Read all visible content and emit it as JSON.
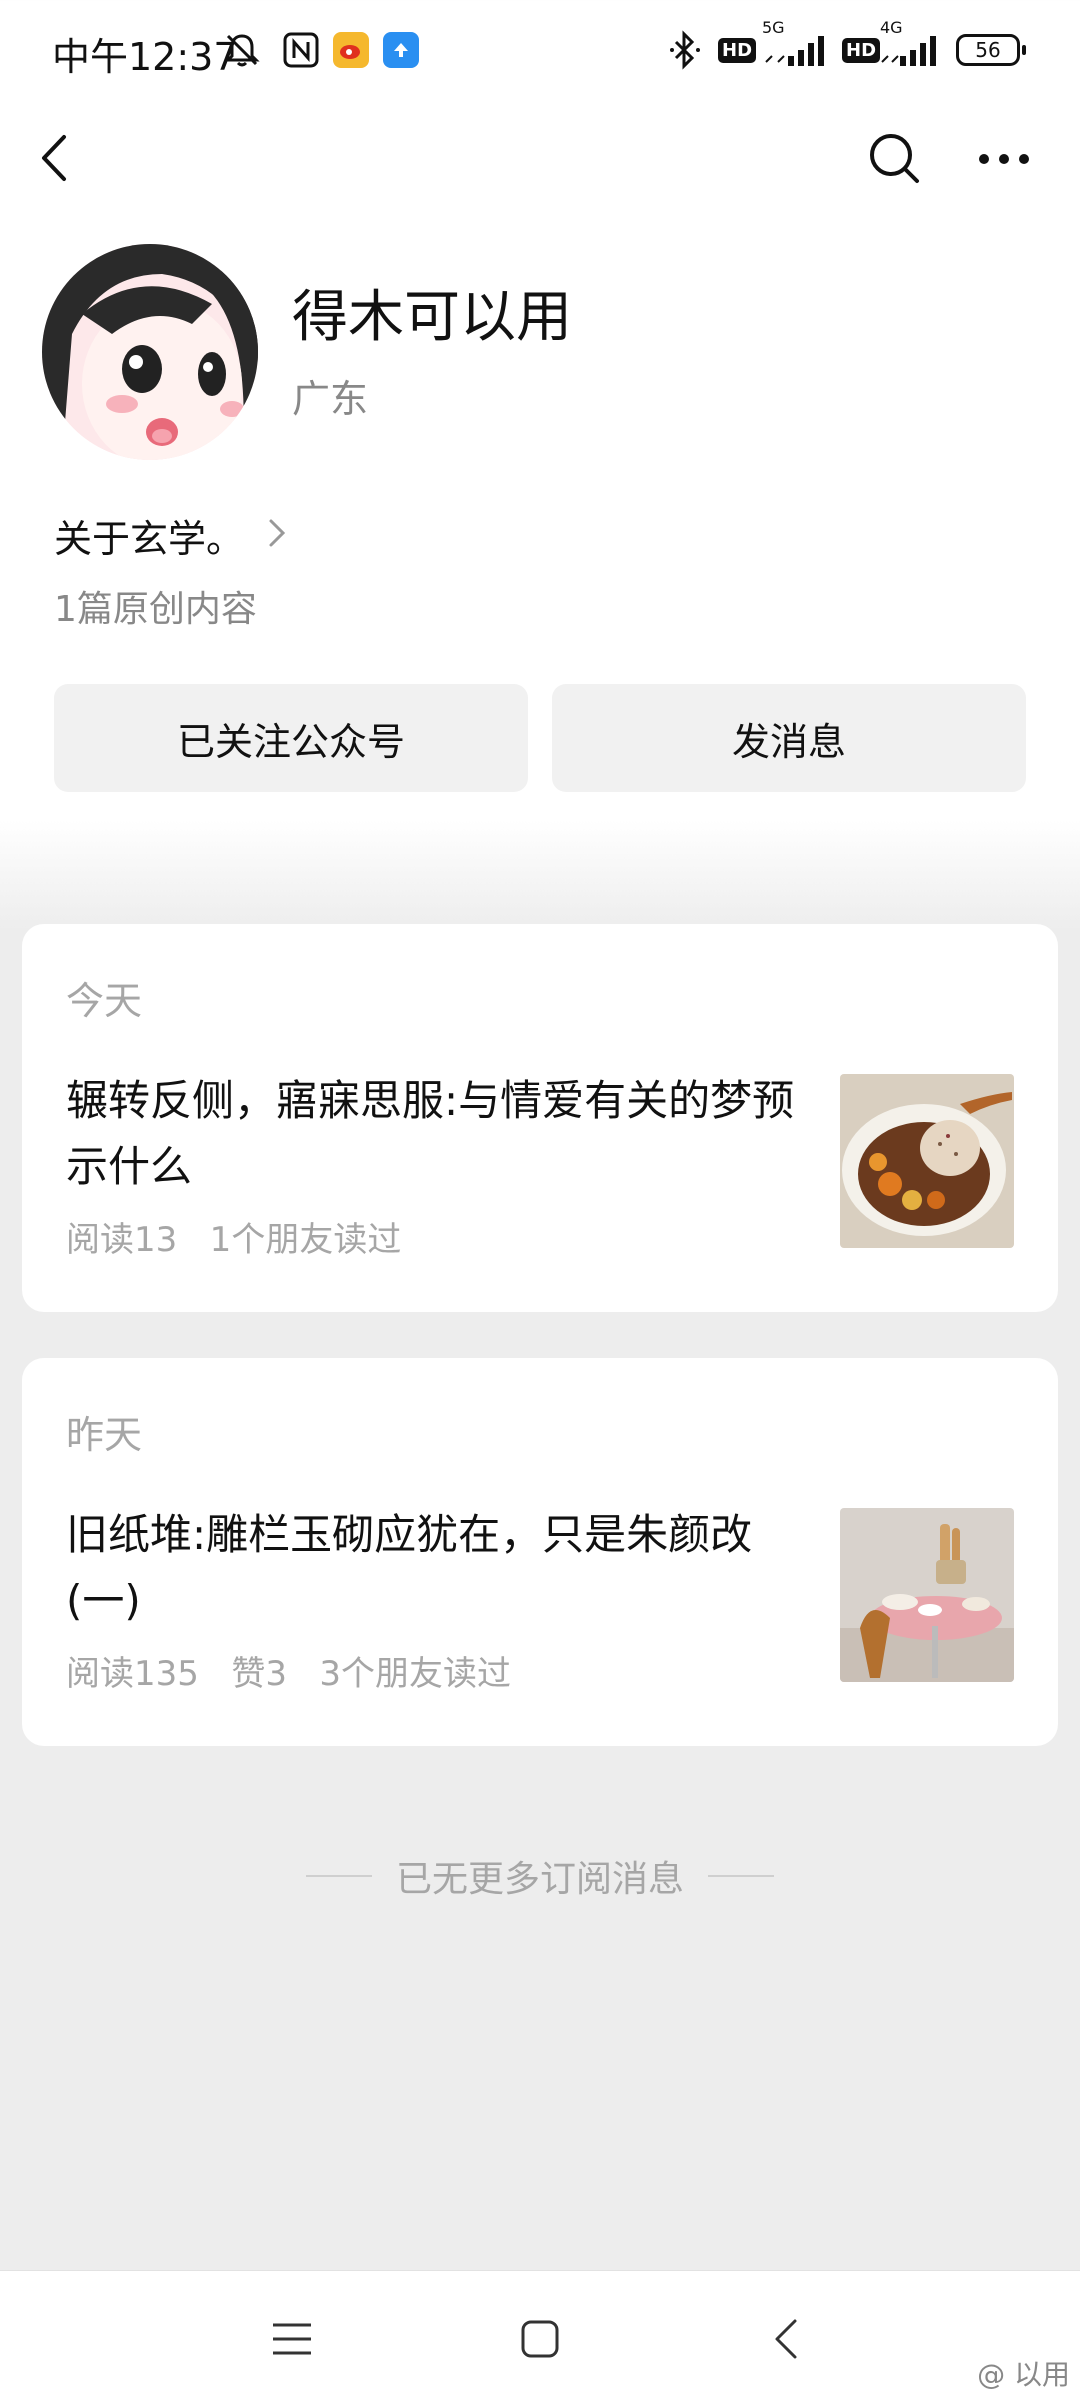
{
  "status_bar": {
    "time": "中午12:37",
    "network1": "5G",
    "network2": "4G",
    "hd": "HD",
    "battery": "56"
  },
  "nav": {
    "back_icon": "back-icon",
    "search_icon": "search-icon",
    "more_icon": "more-icon"
  },
  "profile": {
    "name": "得木可以用",
    "region": "广东",
    "description": "关于玄学。",
    "original_count": "1篇原创内容"
  },
  "actions": {
    "follow_label": "已关注公众号",
    "message_label": "发消息"
  },
  "articles": [
    {
      "date": "今天",
      "title": "辗转反侧，寤寐思服:与情爱有关的梦预示什么",
      "meta": "阅读13   1个朋友读过"
    },
    {
      "date": "昨天",
      "title": "旧纸堆:雕栏玉砌应犹在，只是朱颜改(一)",
      "meta": "阅读135   赞3   3个朋友读过"
    }
  ],
  "footer": {
    "end_text": "已无更多订阅消息"
  },
  "watermark": "@         以用",
  "colors": {
    "background": "#ededed",
    "card": "#ffffff",
    "secondary_text": "#a6a6a6",
    "button_bg": "#f1f1f1"
  }
}
